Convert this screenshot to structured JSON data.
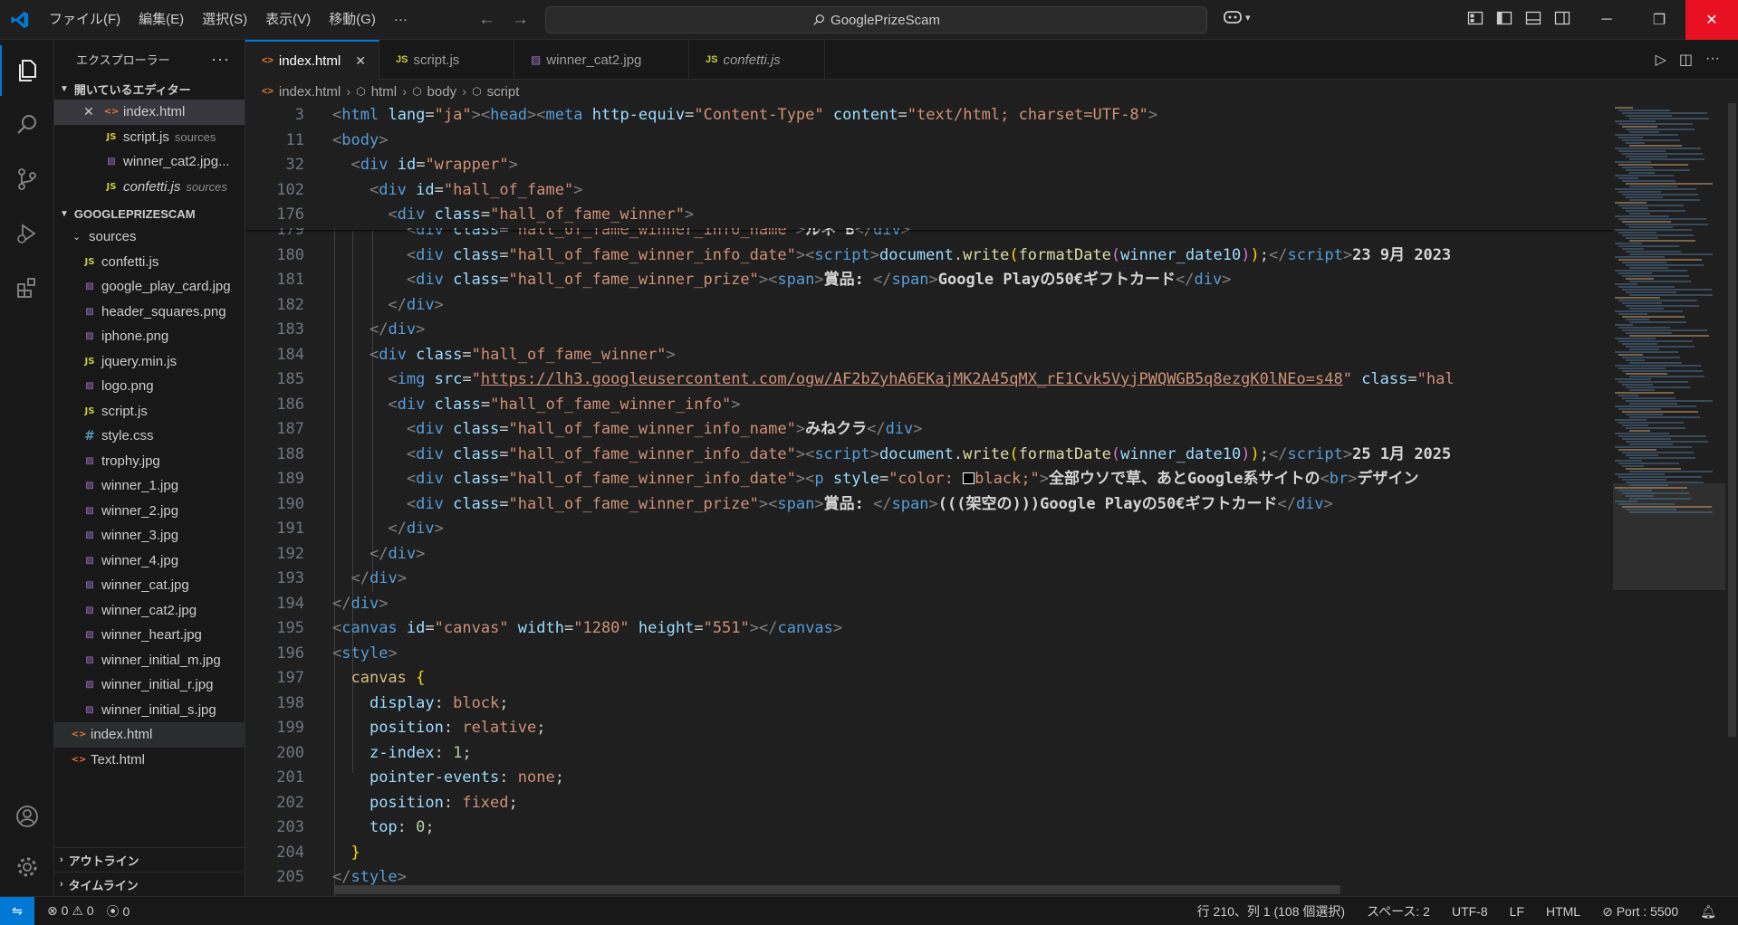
{
  "titlebar": {
    "menu": [
      "ファイル(F)",
      "編集(E)",
      "選択(S)",
      "表示(V)",
      "移動(G)",
      "···"
    ],
    "search_text": "GooglePrizeScam",
    "accent_color": "#0078d4"
  },
  "sidebar": {
    "title": "エクスプローラー",
    "open_editors_label": "開いているエディター",
    "open_editors": [
      {
        "name": "index.html",
        "icon": "html-file-icon"
      },
      {
        "name": "script.js",
        "desc": "sources",
        "icon": "js-file-icon"
      },
      {
        "name": "winner_cat2.jpg...",
        "icon": "image-file-icon"
      },
      {
        "name": "confetti.js",
        "desc": "sources",
        "icon": "js-file-icon"
      }
    ],
    "project_label": "GOOGLEPRIZESCAM",
    "folder": "sources",
    "files": [
      {
        "name": "confetti.js",
        "icon": "js"
      },
      {
        "name": "google_play_card.jpg",
        "icon": "img"
      },
      {
        "name": "header_squares.png",
        "icon": "img"
      },
      {
        "name": "iphone.png",
        "icon": "img"
      },
      {
        "name": "jquery.min.js",
        "icon": "js"
      },
      {
        "name": "logo.png",
        "icon": "img"
      },
      {
        "name": "script.js",
        "icon": "js"
      },
      {
        "name": "style.css",
        "icon": "css"
      },
      {
        "name": "trophy.jpg",
        "icon": "img"
      },
      {
        "name": "winner_1.jpg",
        "icon": "img"
      },
      {
        "name": "winner_2.jpg",
        "icon": "img"
      },
      {
        "name": "winner_3.jpg",
        "icon": "img"
      },
      {
        "name": "winner_4.jpg",
        "icon": "img"
      },
      {
        "name": "winner_cat.jpg",
        "icon": "img"
      },
      {
        "name": "winner_cat2.jpg",
        "icon": "img"
      },
      {
        "name": "winner_heart.jpg",
        "icon": "img"
      },
      {
        "name": "winner_initial_m.jpg",
        "icon": "img"
      },
      {
        "name": "winner_initial_r.jpg",
        "icon": "img"
      },
      {
        "name": "winner_initial_s.jpg",
        "icon": "img"
      }
    ],
    "root_files": [
      {
        "name": "index.html",
        "icon": "html"
      },
      {
        "name": "Text.html",
        "icon": "html"
      }
    ],
    "outline_label": "アウトライン",
    "timeline_label": "タイムライン"
  },
  "tabs": [
    {
      "label": "index.html",
      "icon": "html",
      "active": true
    },
    {
      "label": "script.js",
      "icon": "js",
      "active": false
    },
    {
      "label": "winner_cat2.jpg",
      "icon": "img",
      "active": false
    },
    {
      "label": "confetti.js",
      "icon": "js",
      "active": false,
      "italic": true
    }
  ],
  "breadcrumb": [
    "index.html",
    "html",
    "body",
    "script"
  ],
  "editor": {
    "sticky_lines": [
      "3",
      "11",
      "32",
      "102",
      "176"
    ],
    "line_numbers": [
      "179",
      "180",
      "181",
      "182",
      "183",
      "184",
      "185",
      "186",
      "187",
      "188",
      "189",
      "190",
      "191",
      "192",
      "193",
      "194",
      "195",
      "196",
      "197",
      "198",
      "199",
      "200",
      "201",
      "202",
      "203",
      "204",
      "205"
    ]
  },
  "statusbar": {
    "errors": "0",
    "warnings": "0",
    "ports_count": "0",
    "position": "行 210、列 1 (108 個選択)",
    "spaces": "スペース: 2",
    "encoding": "UTF-8",
    "eol": "LF",
    "language": "HTML",
    "port": "Port : 5500"
  }
}
